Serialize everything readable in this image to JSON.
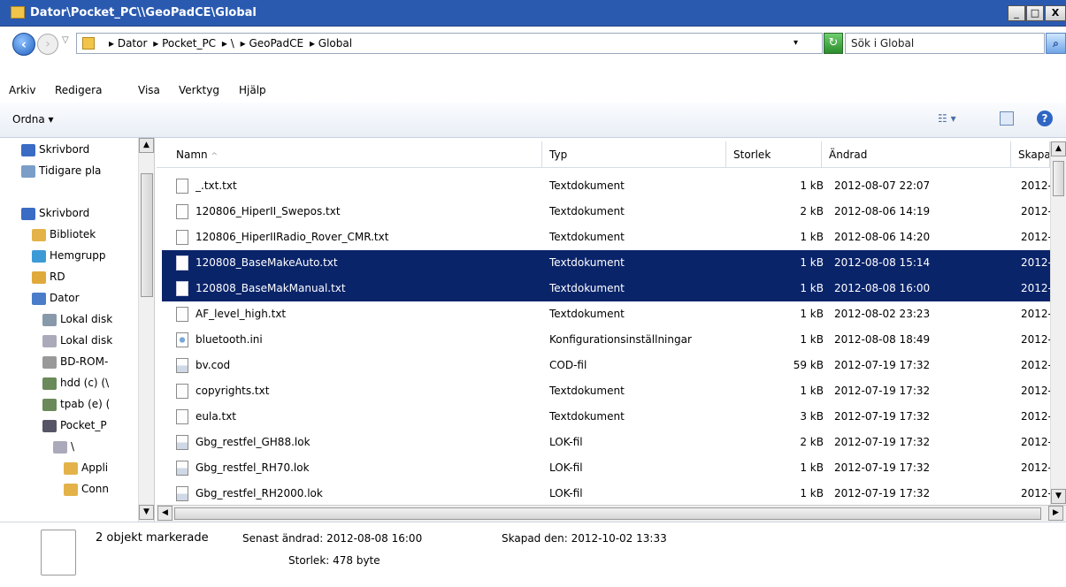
{
  "window": {
    "title": "Dator\\Pocket_PC\\\\GeoPadCE\\Global",
    "minimize": "_",
    "maximize": "□",
    "close": "X"
  },
  "address": {
    "crumbs": [
      "▸ Dator",
      "▸ Pocket_PC",
      "▸ \\",
      "▸ GeoPadCE",
      "▸ Global"
    ],
    "dropdown": "▾",
    "search_placeholder": "Sök i Global"
  },
  "menu": [
    "Arkiv",
    "Redigera",
    "Visa",
    "Verktyg",
    "Hjälp"
  ],
  "command_bar": {
    "organize": "Ordna ▾",
    "view": "☷ ▾",
    "help": "?"
  },
  "nav": {
    "items": [
      {
        "label": "Skrivbord",
        "color": "#3a6cc4",
        "indent": 0
      },
      {
        "label": "Tidigare pla",
        "color": "#7a9ec7",
        "indent": 0
      },
      {
        "label": "",
        "color": "",
        "indent": 0
      },
      {
        "label": "Skrivbord",
        "color": "#3a6cc4",
        "indent": 0
      },
      {
        "label": "Bibliotek",
        "color": "#e3b34a",
        "indent": 1
      },
      {
        "label": "Hemgrupp",
        "color": "#3c9bd6",
        "indent": 1
      },
      {
        "label": "RD",
        "color": "#e0a93b",
        "indent": 1
      },
      {
        "label": "Dator",
        "color": "#4a7cc9",
        "indent": 1
      },
      {
        "label": "Lokal disk",
        "color": "#8899aa",
        "indent": 2
      },
      {
        "label": "Lokal disk",
        "color": "#aab",
        "indent": 2
      },
      {
        "label": "BD-ROM-",
        "color": "#999",
        "indent": 2
      },
      {
        "label": "hdd (c) (\\",
        "color": "#6a8a5a",
        "indent": 2
      },
      {
        "label": "tpab (e) (",
        "color": "#6a8a5a",
        "indent": 2
      },
      {
        "label": "Pocket_P",
        "color": "#556",
        "indent": 2
      },
      {
        "label": "\\",
        "color": "#aab",
        "indent": 3
      },
      {
        "label": "Appli",
        "color": "#e3b34a",
        "indent": 4
      },
      {
        "label": "Conn",
        "color": "#e3b34a",
        "indent": 4
      }
    ]
  },
  "columns": {
    "name": "Namn",
    "type": "Typ",
    "size": "Storlek",
    "modified": "Ändrad",
    "created": "Skapa"
  },
  "files": [
    {
      "name": "_.txt.txt",
      "type": "Textdokument",
      "size": "1 kB",
      "modified": "2012-08-07 22:07",
      "created": "2012-",
      "icon": "txt",
      "selected": false
    },
    {
      "name": "120806_HiperII_Swepos.txt",
      "type": "Textdokument",
      "size": "2 kB",
      "modified": "2012-08-06 14:19",
      "created": "2012-",
      "icon": "txt",
      "selected": false
    },
    {
      "name": "120806_HiperIIRadio_Rover_CMR.txt",
      "type": "Textdokument",
      "size": "1 kB",
      "modified": "2012-08-06 14:20",
      "created": "2012-",
      "icon": "txt",
      "selected": false
    },
    {
      "name": "120808_BaseMakeAuto.txt",
      "type": "Textdokument",
      "size": "1 kB",
      "modified": "2012-08-08 15:14",
      "created": "2012-",
      "icon": "txt",
      "selected": true
    },
    {
      "name": "120808_BaseMakManual.txt",
      "type": "Textdokument",
      "size": "1 kB",
      "modified": "2012-08-08 16:00",
      "created": "2012-",
      "icon": "txt",
      "selected": true
    },
    {
      "name": "AF_level_high.txt",
      "type": "Textdokument",
      "size": "1 kB",
      "modified": "2012-08-02 23:23",
      "created": "2012-",
      "icon": "txt",
      "selected": false
    },
    {
      "name": "bluetooth.ini",
      "type": "Konfigurationsinställningar",
      "size": "1 kB",
      "modified": "2012-08-08 18:49",
      "created": "2012-",
      "icon": "ini",
      "selected": false
    },
    {
      "name": "bv.cod",
      "type": "COD-fil",
      "size": "59 kB",
      "modified": "2012-07-19 17:32",
      "created": "2012-",
      "icon": "cod",
      "selected": false
    },
    {
      "name": "copyrights.txt",
      "type": "Textdokument",
      "size": "1 kB",
      "modified": "2012-07-19 17:32",
      "created": "2012-",
      "icon": "txt",
      "selected": false
    },
    {
      "name": "eula.txt",
      "type": "Textdokument",
      "size": "3 kB",
      "modified": "2012-07-19 17:32",
      "created": "2012-",
      "icon": "txt",
      "selected": false
    },
    {
      "name": "Gbg_restfel_GH88.lok",
      "type": "LOK-fil",
      "size": "2 kB",
      "modified": "2012-07-19 17:32",
      "created": "2012-",
      "icon": "lok",
      "selected": false
    },
    {
      "name": "Gbg_restfel_RH70.lok",
      "type": "LOK-fil",
      "size": "1 kB",
      "modified": "2012-07-19 17:32",
      "created": "2012-",
      "icon": "lok",
      "selected": false
    },
    {
      "name": "Gbg_restfel_RH2000.lok",
      "type": "LOK-fil",
      "size": "1 kB",
      "modified": "2012-07-19 17:32",
      "created": "2012-",
      "icon": "lok",
      "selected": false
    }
  ],
  "details": {
    "selection": "2 objekt markerade",
    "modified": "Senast ändrad: 2012-08-08 16:00",
    "created": "Skapad den: 2012-10-02 13:33",
    "size": "Storlek: 478 byte"
  },
  "colors": {
    "selection": "#0a246a",
    "titlebar": "#2a5ab0"
  }
}
